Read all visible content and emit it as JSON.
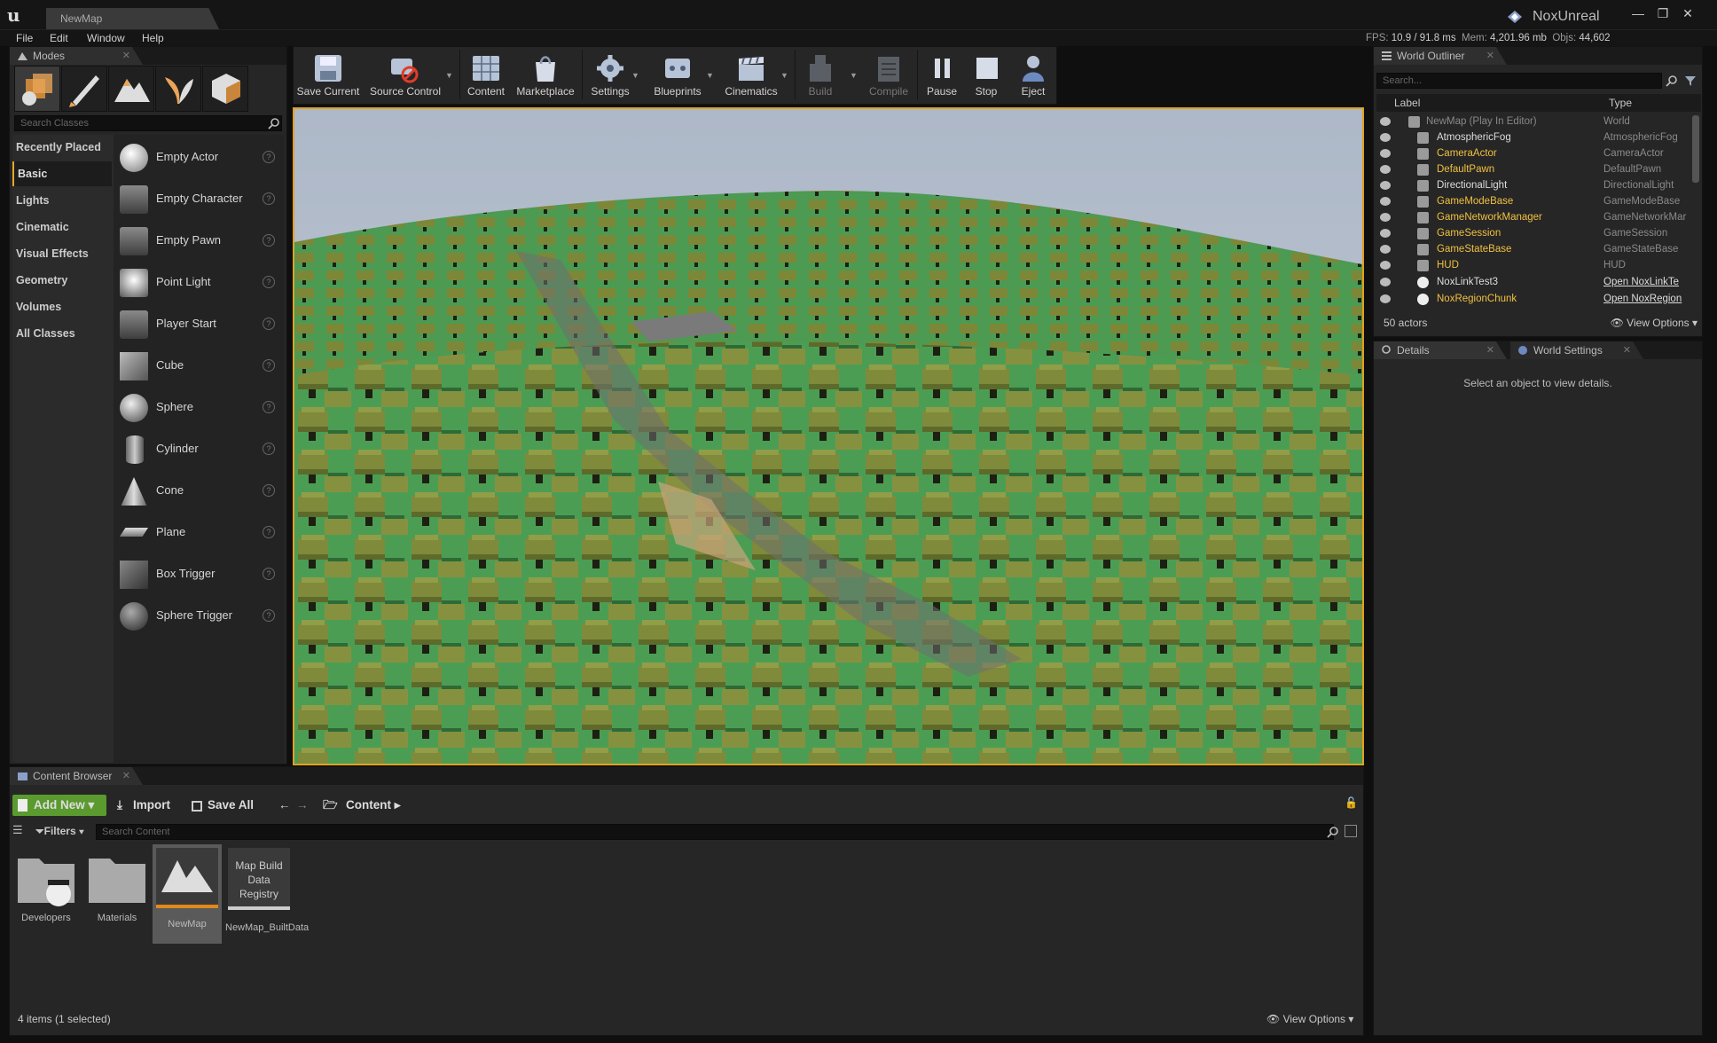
{
  "window": {
    "doc_tab": "NewMap",
    "project_name": "NoxUnreal",
    "minimize": "—",
    "restore": "❐",
    "close": "✕"
  },
  "menu": [
    "File",
    "Edit",
    "Window",
    "Help"
  ],
  "stats": {
    "fps_label": "FPS:",
    "fps": "10.9 / 91.8 ms",
    "mem_label": "Mem:",
    "mem": "4,201.96 mb",
    "objs_label": "Objs:",
    "objs": "44,602"
  },
  "modes": {
    "tab": "Modes",
    "search_placeholder": "Search Classes",
    "categories": [
      "Recently Placed",
      "Basic",
      "Lights",
      "Cinematic",
      "Visual Effects",
      "Geometry",
      "Volumes",
      "All Classes"
    ],
    "selected_category": "Basic",
    "items": [
      "Empty Actor",
      "Empty Character",
      "Empty Pawn",
      "Point Light",
      "Player Start",
      "Cube",
      "Sphere",
      "Cylinder",
      "Cone",
      "Plane",
      "Box Trigger",
      "Sphere Trigger"
    ],
    "help": "?"
  },
  "toolbar": {
    "save_current": "Save Current",
    "source_control": "Source Control",
    "content": "Content",
    "marketplace": "Marketplace",
    "settings": "Settings",
    "blueprints": "Blueprints",
    "cinematics": "Cinematics",
    "build": "Build",
    "compile": "Compile",
    "pause": "Pause",
    "stop": "Stop",
    "eject": "Eject"
  },
  "outliner": {
    "tab": "World Outliner",
    "search_placeholder": "Search...",
    "col_label": "Label",
    "col_type": "Type",
    "rows": [
      {
        "label": "NewMap (Play In Editor)",
        "type": "World"
      },
      {
        "label": "AtmosphericFog",
        "type": "AtmosphericFog"
      },
      {
        "label": "CameraActor",
        "type": "CameraActor"
      },
      {
        "label": "DefaultPawn",
        "type": "DefaultPawn"
      },
      {
        "label": "DirectionalLight",
        "type": "DirectionalLight"
      },
      {
        "label": "GameModeBase",
        "type": "GameModeBase"
      },
      {
        "label": "GameNetworkManager",
        "type": "GameNetworkMar"
      },
      {
        "label": "GameSession",
        "type": "GameSession"
      },
      {
        "label": "GameStateBase",
        "type": "GameStateBase"
      },
      {
        "label": "HUD",
        "type": "HUD"
      },
      {
        "label": "NoxLinkTest3",
        "type": "Open NoxLinkTe"
      },
      {
        "label": "NoxRegionChunk",
        "type": "Open NoxRegion"
      }
    ],
    "actor_count": "50 actors",
    "view_options": "View Options"
  },
  "details": {
    "tab_details": "Details",
    "tab_world": "World Settings",
    "empty_message": "Select an object to view details."
  },
  "content_browser": {
    "tab": "Content Browser",
    "add_new": "Add New",
    "import": "Import",
    "save_all": "Save All",
    "path": "Content",
    "filters": "Filters",
    "search_placeholder": "Search Content",
    "assets": [
      {
        "name": "Developers"
      },
      {
        "name": "Materials"
      },
      {
        "name": "NewMap"
      },
      {
        "name": "NewMap_BuiltData",
        "thumb_text": "Map Build Data Registry"
      }
    ],
    "status": "4 items (1 selected)",
    "view_options": "View Options"
  },
  "colors": {
    "accent": "#e0a220",
    "panel": "#262626",
    "add_new_green": "#5a9a2e"
  }
}
